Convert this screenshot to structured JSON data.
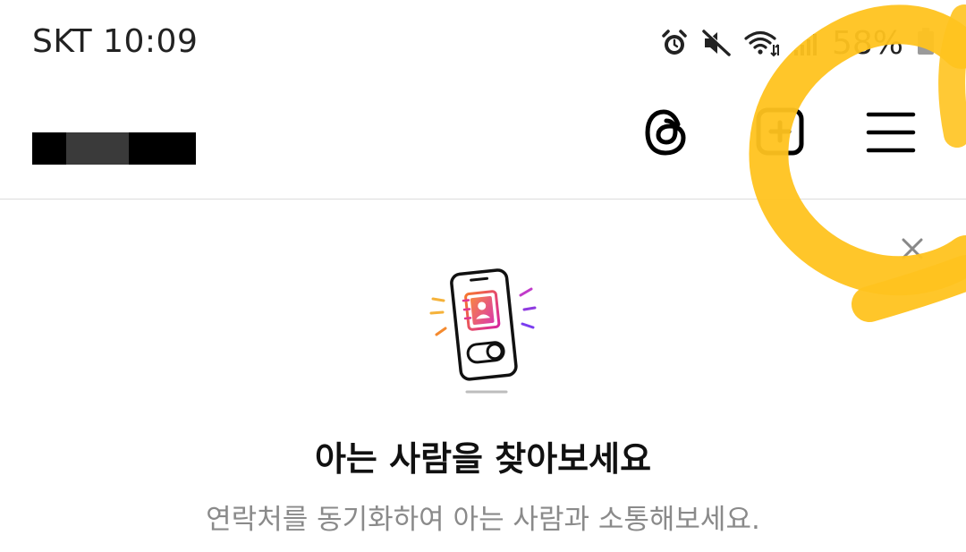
{
  "status_bar": {
    "carrier_time": "SKT 10:09",
    "battery_percent": "58%",
    "icons": [
      "alarm-icon",
      "mute-icon",
      "wifi-icon",
      "signal-icon",
      "battery-icon"
    ]
  },
  "header": {
    "username_redacted": true,
    "icons": [
      "threads-icon",
      "create-post-icon",
      "menu-icon"
    ]
  },
  "suggestion": {
    "illustration": "phone-contacts-icon",
    "title": "아는 사람을 찾아보세요",
    "description": "연락처를 동기화하여 아는 사람과 소통해보세요."
  },
  "annotation": {
    "color": "#FFC31F"
  }
}
